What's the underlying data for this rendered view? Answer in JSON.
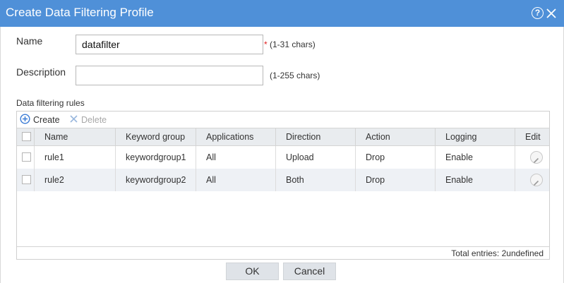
{
  "dialog": {
    "title": "Create Data Filtering Profile",
    "help_glyph": "?",
    "name_label": "Name",
    "name_value": "datafilter",
    "name_required_mark": "*",
    "name_hint": "(1-31 chars)",
    "description_label": "Description",
    "description_value": "",
    "description_hint": "(1-255 chars)"
  },
  "rules": {
    "section_label": "Data filtering rules",
    "toolbar": {
      "create_label": "Create",
      "delete_label": "Delete"
    },
    "columns": [
      "Name",
      "Keyword group",
      "Applications",
      "Direction",
      "Action",
      "Logging",
      "Edit"
    ],
    "rows": [
      {
        "name": "rule1",
        "keyword_group": "keywordgroup1",
        "applications": "All",
        "direction": "Upload",
        "action": "Drop",
        "logging": "Enable"
      },
      {
        "name": "rule2",
        "keyword_group": "keywordgroup2",
        "applications": "All",
        "direction": "Both",
        "action": "Drop",
        "logging": "Enable"
      }
    ],
    "total_entries": "Total entries: 2undefined"
  },
  "buttons": {
    "ok_label": "OK",
    "cancel_label": "Cancel"
  },
  "colors": {
    "titlebar": "#4f90d8",
    "required": "#e02020",
    "header_bg": "#e9ecef",
    "alt_row": "#eef1f5",
    "button_bg": "#dfe3e8"
  },
  "icons": [
    "help-icon",
    "close-icon",
    "create-plus-icon",
    "delete-x-icon",
    "edit-pencil-icon"
  ]
}
